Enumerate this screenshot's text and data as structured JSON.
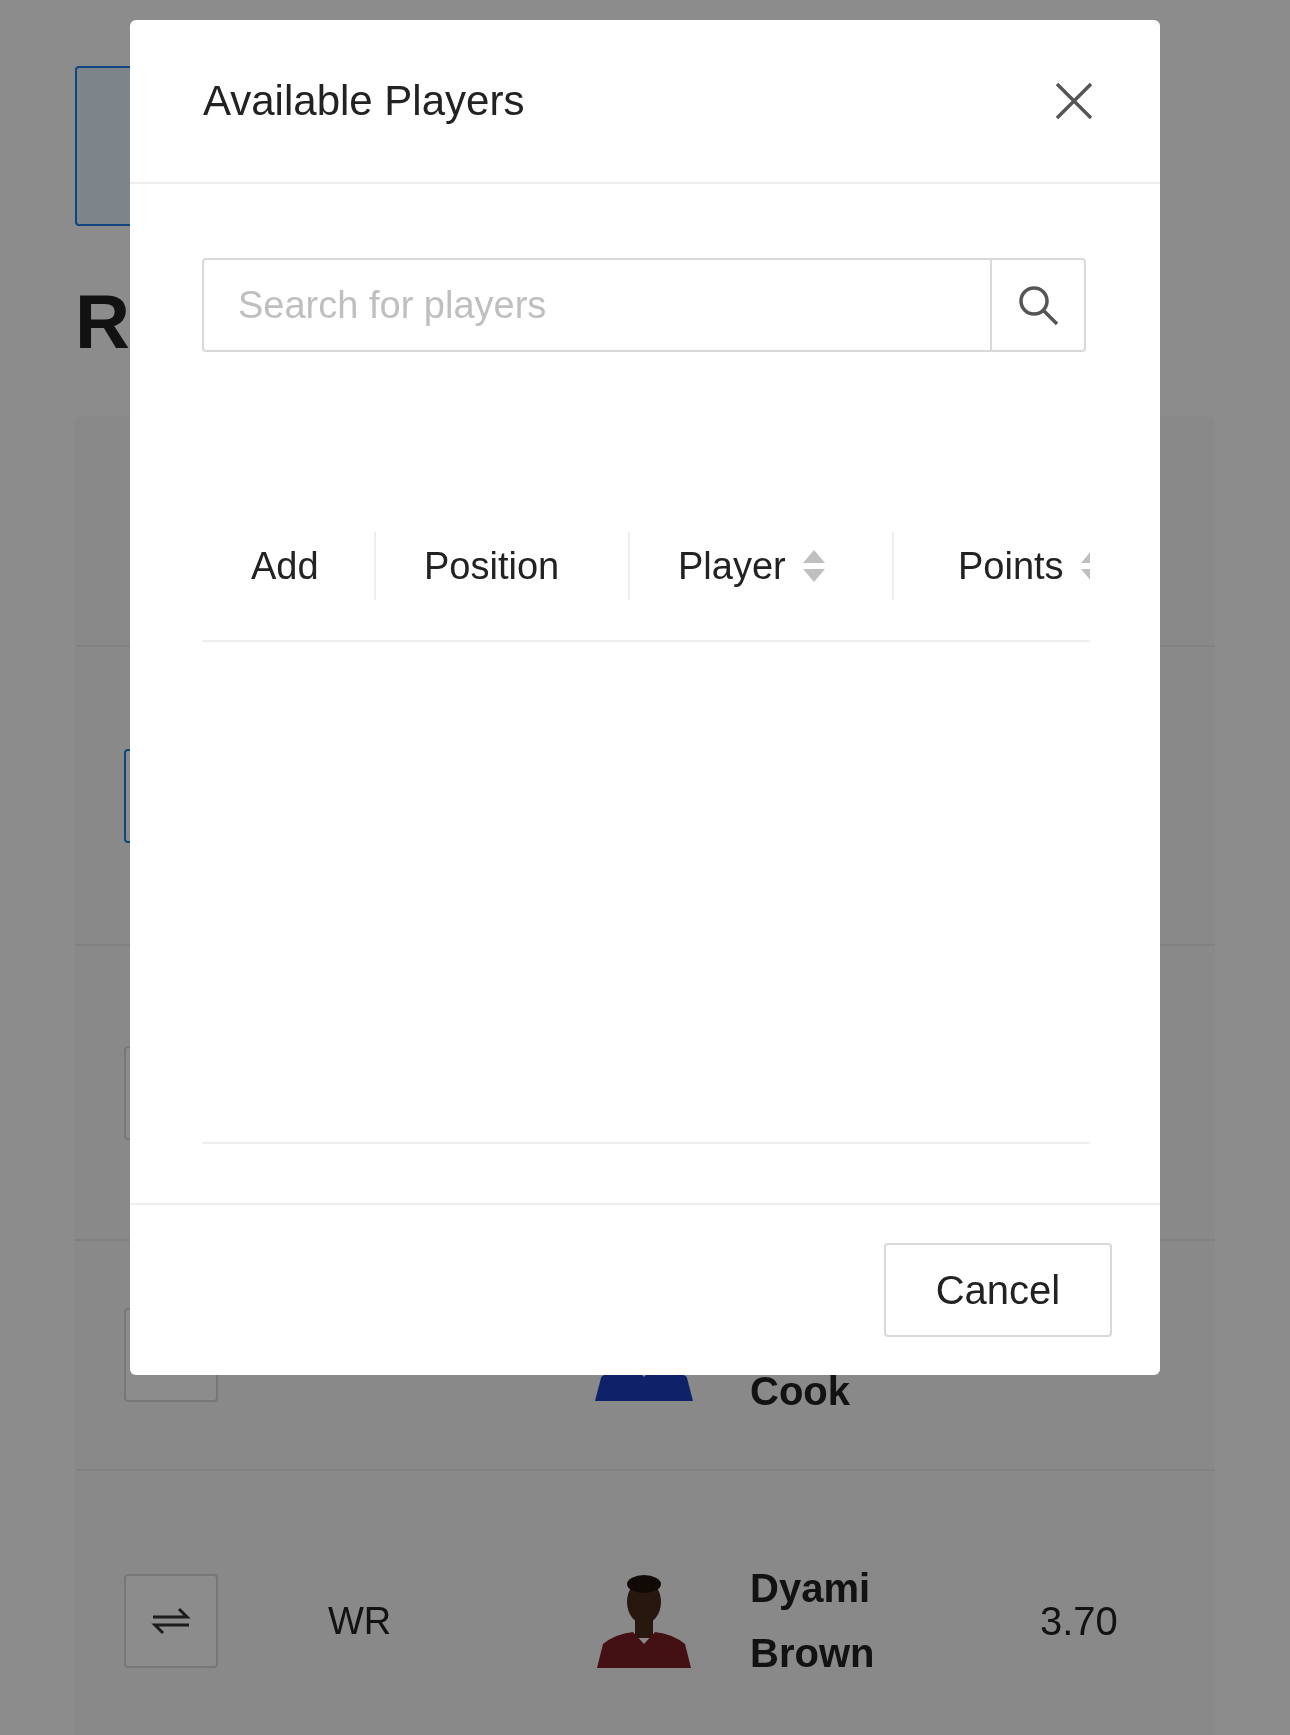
{
  "page": {
    "heading": "R",
    "roster": [
      {
        "selected": true
      },
      {
        "selected": false
      },
      {
        "selected": false,
        "player": "Cook",
        "photo": true
      },
      {
        "selected": false,
        "position": "WR",
        "player": "Dyami Brown",
        "points": "3.70",
        "photo": true
      }
    ]
  },
  "modal": {
    "title": "Available Players",
    "search": {
      "placeholder": "Search for players"
    },
    "table": {
      "columns": [
        {
          "label": "Add",
          "sortable": false
        },
        {
          "label": "Position",
          "sortable": false
        },
        {
          "label": "Player",
          "sortable": true
        },
        {
          "label": "Points",
          "sortable": true
        }
      ]
    },
    "buttons": [
      "Cancel"
    ]
  }
}
